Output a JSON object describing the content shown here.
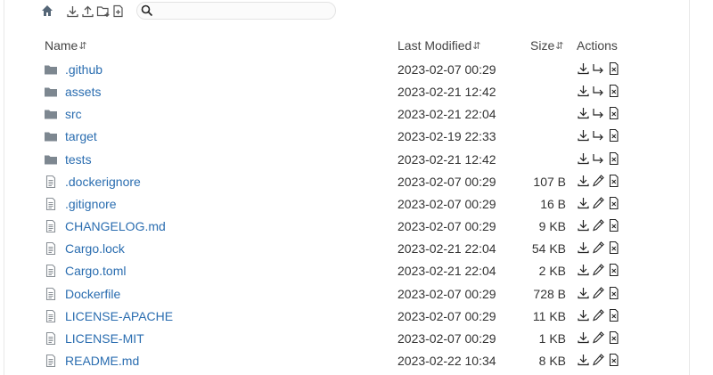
{
  "toolbar": {
    "search": {
      "placeholder": "",
      "value": ""
    },
    "buttons": [
      "home-icon",
      "download-icon",
      "upload-icon",
      "new-folder-icon",
      "new-file-icon",
      "search-icon"
    ]
  },
  "table": {
    "headers": {
      "name": "Name",
      "modified": "Last Modified",
      "size": "Size",
      "actions": "Actions",
      "sort_glyph": "⇵"
    },
    "rows": [
      {
        "name": ".github",
        "modified": "2023-02-07 00:29",
        "size": "",
        "type": "folder"
      },
      {
        "name": "assets",
        "modified": "2023-02-21 12:42",
        "size": "",
        "type": "folder"
      },
      {
        "name": "src",
        "modified": "2023-02-21 22:04",
        "size": "",
        "type": "folder"
      },
      {
        "name": "target",
        "modified": "2023-02-19 22:33",
        "size": "",
        "type": "folder"
      },
      {
        "name": "tests",
        "modified": "2023-02-21 12:42",
        "size": "",
        "type": "folder"
      },
      {
        "name": ".dockerignore",
        "modified": "2023-02-07 00:29",
        "size": "107 B",
        "type": "file"
      },
      {
        "name": ".gitignore",
        "modified": "2023-02-07 00:29",
        "size": "16 B",
        "type": "file"
      },
      {
        "name": "CHANGELOG.md",
        "modified": "2023-02-07 00:29",
        "size": "9 KB",
        "type": "file"
      },
      {
        "name": "Cargo.lock",
        "modified": "2023-02-21 22:04",
        "size": "54 KB",
        "type": "file"
      },
      {
        "name": "Cargo.toml",
        "modified": "2023-02-21 22:04",
        "size": "2 KB",
        "type": "file"
      },
      {
        "name": "Dockerfile",
        "modified": "2023-02-07 00:29",
        "size": "728 B",
        "type": "file"
      },
      {
        "name": "LICENSE-APACHE",
        "modified": "2023-02-07 00:29",
        "size": "11 KB",
        "type": "file"
      },
      {
        "name": "LICENSE-MIT",
        "modified": "2023-02-07 00:29",
        "size": "1 KB",
        "type": "file"
      },
      {
        "name": "README.md",
        "modified": "2023-02-22 10:34",
        "size": "8 KB",
        "type": "file"
      }
    ]
  },
  "colors": {
    "link": "#2a6db0",
    "icon": "#8a9096",
    "text": "#333333"
  }
}
